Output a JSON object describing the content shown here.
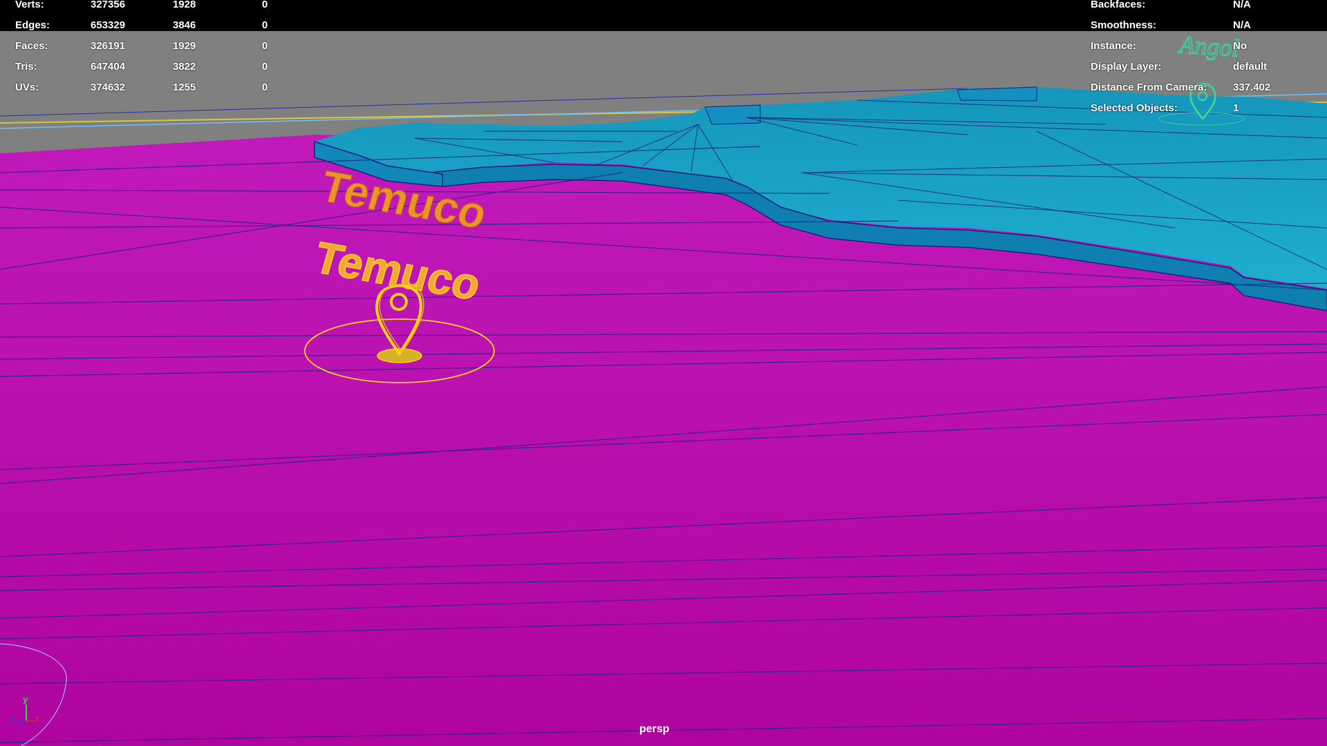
{
  "stats_left": {
    "rows": [
      {
        "label": "Verts:",
        "v1": "327356",
        "v2": "1928",
        "v3": "0"
      },
      {
        "label": "Edges:",
        "v1": "653329",
        "v2": "3846",
        "v3": "0"
      },
      {
        "label": "Faces:",
        "v1": "326191",
        "v2": "1929",
        "v3": "0"
      },
      {
        "label": "Tris:",
        "v1": "647404",
        "v2": "3822",
        "v3": "0"
      },
      {
        "label": "UVs:",
        "v1": "374632",
        "v2": "1255",
        "v3": "0"
      }
    ]
  },
  "stats_right": {
    "rows": [
      {
        "label": "Backfaces:",
        "value": "N/A"
      },
      {
        "label": "Smoothness:",
        "value": "N/A"
      },
      {
        "label": "Instance:",
        "value": "No"
      },
      {
        "label": "Display Layer:",
        "value": "default"
      },
      {
        "label": "Distance From Camera:",
        "value": "337.402"
      },
      {
        "label": "Selected Objects:",
        "value": "1"
      }
    ]
  },
  "scene": {
    "labels": {
      "temuco_1": "Temuco",
      "temuco_2": "Temuco",
      "angol": "Angol"
    },
    "camera_name": "persp",
    "colors": {
      "ground": "#b40fb0",
      "sky_band": "#808080",
      "top_bar": "#000000",
      "land_raised": "#1ca6c8",
      "edges": "#1a1f7a",
      "selection": "#ffd21a",
      "text_orange": "#e8962c",
      "angol_green": "#3ecf9a"
    },
    "axis": {
      "y": "y",
      "z": "z",
      "x": "x"
    }
  }
}
